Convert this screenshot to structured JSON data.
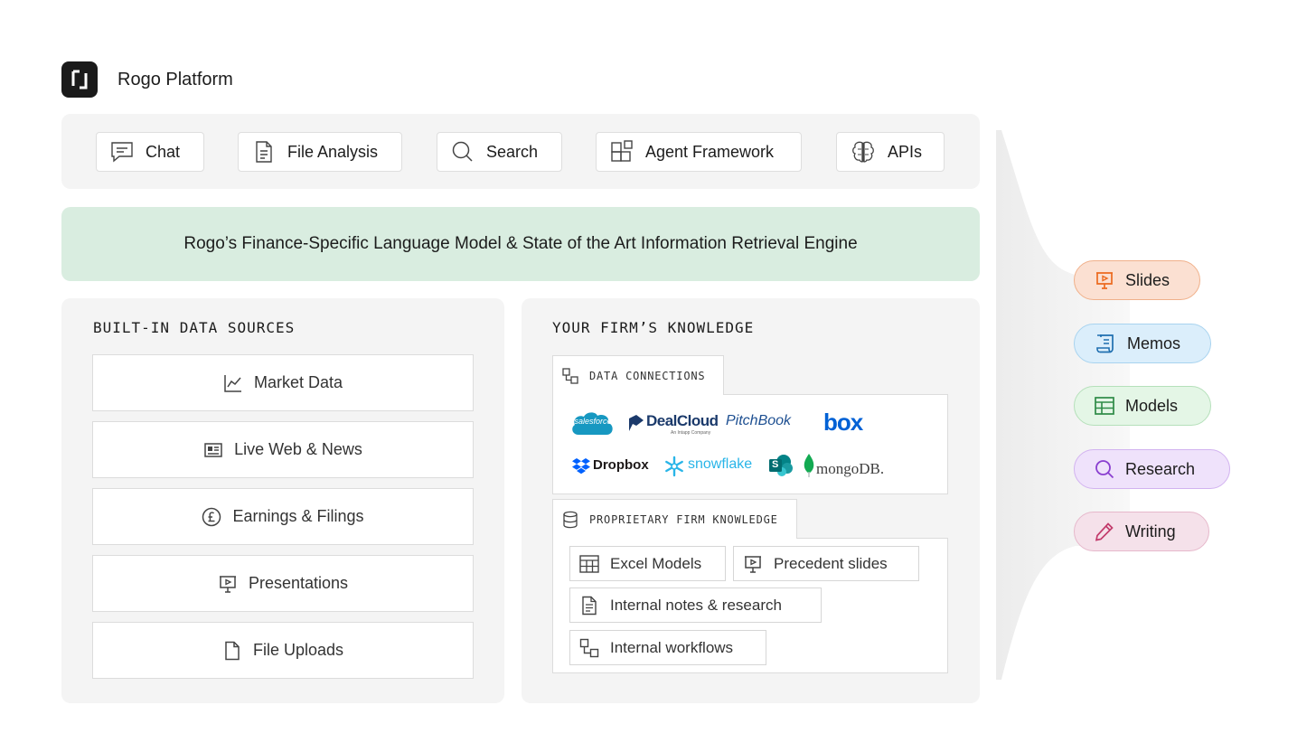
{
  "header": {
    "title": "Rogo Platform"
  },
  "toolbar": {
    "items": [
      {
        "label": "Chat",
        "icon": "chat-icon"
      },
      {
        "label": "File Analysis",
        "icon": "document-icon"
      },
      {
        "label": "Search",
        "icon": "search-icon"
      },
      {
        "label": "Agent Framework",
        "icon": "blocks-icon"
      },
      {
        "label": "APIs",
        "icon": "brain-icon"
      }
    ]
  },
  "engine": {
    "label": "Rogo’s Finance-Specific Language Model & State of the Art Information Retrieval Engine"
  },
  "builtin": {
    "heading": "BUILT-IN DATA SOURCES",
    "items": [
      {
        "label": "Market Data",
        "icon": "line-chart-icon"
      },
      {
        "label": "Live Web & News",
        "icon": "newspaper-icon"
      },
      {
        "label": "Earnings & Filings",
        "icon": "pound-coin-icon"
      },
      {
        "label": "Presentations",
        "icon": "presentation-icon"
      },
      {
        "label": "File Uploads",
        "icon": "file-icon"
      }
    ]
  },
  "firm": {
    "heading": "YOUR FIRM’S KNOWLEDGE",
    "connections": {
      "heading": "DATA CONNECTIONS",
      "logos": {
        "salesforce": "salesforce",
        "dealcloud": "DealCloud",
        "dealcloud_sub": "An Intapp Company",
        "pitchbook": "PitchBook",
        "box": "box",
        "dropbox": "Dropbox",
        "snowflake": "snowflake",
        "sharepoint": "S",
        "mongodb": "mongoDB."
      }
    },
    "proprietary": {
      "heading": "PROPRIETARY FIRM KNOWLEDGE",
      "items": [
        {
          "label": "Excel Models",
          "icon": "table-icon"
        },
        {
          "label": "Precedent slides",
          "icon": "presentation-icon"
        },
        {
          "label": "Internal notes & research",
          "icon": "document-icon"
        },
        {
          "label": "Internal workflows",
          "icon": "workflow-icon"
        }
      ]
    }
  },
  "outputs": {
    "items": [
      {
        "label": "Slides",
        "icon": "presentation-icon",
        "bg": "#fbe0d2",
        "border": "#f0b08a",
        "accent": "#ec6a1f"
      },
      {
        "label": "Memos",
        "icon": "scroll-icon",
        "bg": "#dbeefb",
        "border": "#a8d3ef",
        "accent": "#1f6fb0"
      },
      {
        "label": "Models",
        "icon": "table-icon",
        "bg": "#e4f6e6",
        "border": "#b5e0ba",
        "accent": "#2e8b46"
      },
      {
        "label": "Research",
        "icon": "search-icon",
        "bg": "#efe2fb",
        "border": "#d2b3f0",
        "accent": "#8a3fd0"
      },
      {
        "label": "Writing",
        "icon": "pencil-icon",
        "bg": "#f5e1ea",
        "border": "#e6b8cb",
        "accent": "#c23a6b"
      }
    ]
  }
}
